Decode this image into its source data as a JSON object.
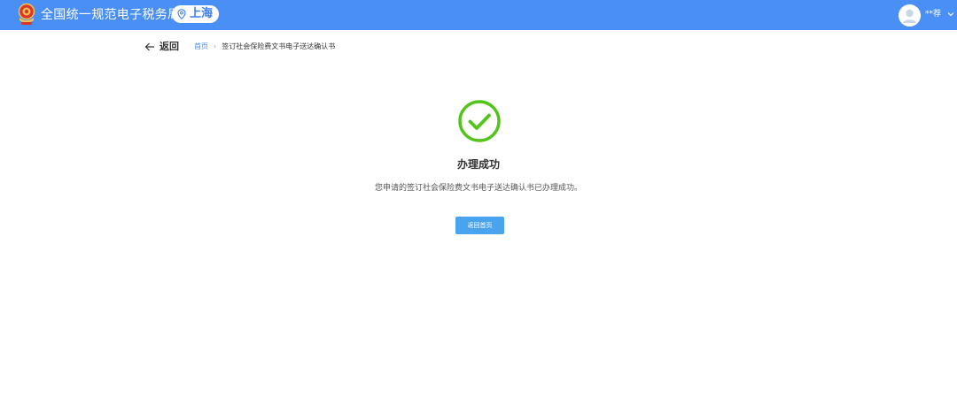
{
  "header": {
    "site_title": "全国统一规范电子税务局",
    "city": "上海",
    "user_name": "**荐"
  },
  "nav": {
    "back_label": "返回",
    "breadcrumb": {
      "home": "首页",
      "separator": "›",
      "current": "签订社会保险费文书电子送达确认书"
    }
  },
  "result": {
    "title": "办理成功",
    "message": "您申请的签订社会保险费文书电子送达确认书已办理成功。",
    "button_label": "返回首页"
  },
  "colors": {
    "header_bg": "#4a8ff5",
    "success_green": "#52c41a",
    "button_bg": "#4aa3ee",
    "link_blue": "#4a8ff5"
  },
  "icons": {
    "logo": "tax-emblem-icon",
    "city": "location-pin-icon",
    "user": "user-avatar-icon",
    "user_menu": "chevron-down-icon",
    "back": "arrow-left-icon",
    "success": "check-circle-icon"
  }
}
